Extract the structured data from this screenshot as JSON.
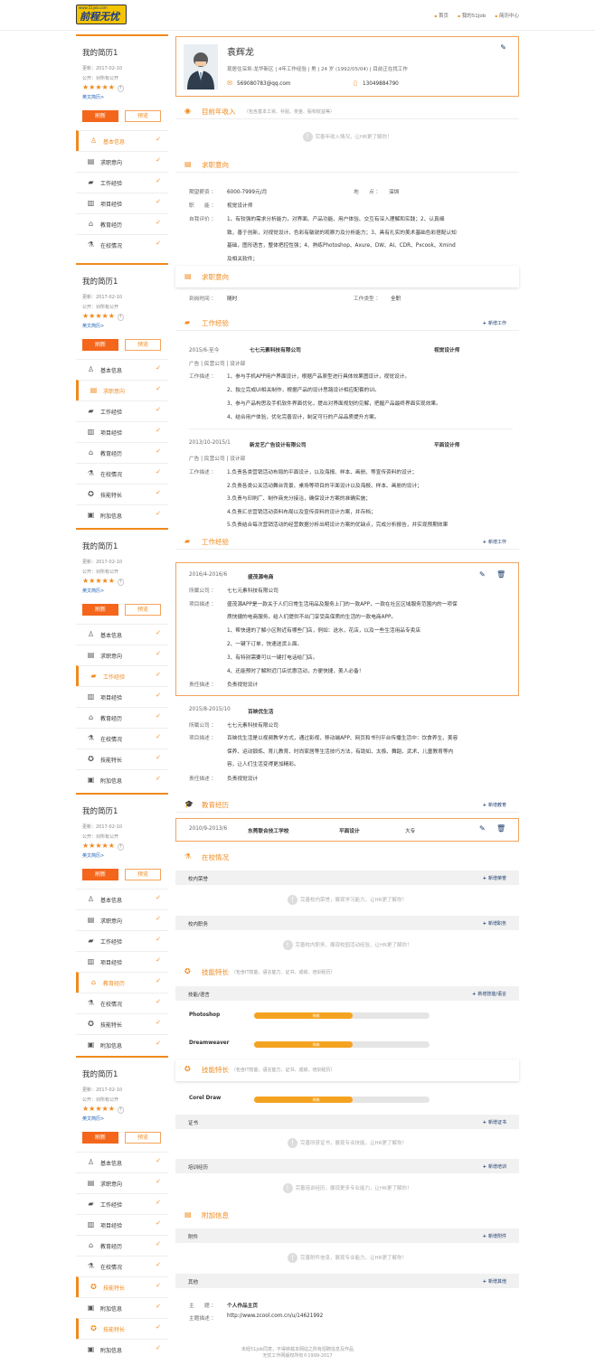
{
  "header": {
    "logo_url": "www.51job.com",
    "logo_text": "前程无忧",
    "nav": [
      "首页",
      "我的51Job",
      "简历中心"
    ]
  },
  "sidebar_blocks": [
    {
      "title": "我的简历1",
      "updated": "更新：2017-02-10",
      "public": "公开：对所有公开",
      "stars": "★★★★★",
      "en": "英文简历>",
      "refresh": "刷新",
      "preview": "预览",
      "items": [
        "基本信息",
        "求职意向",
        "工作经验",
        "项目经验",
        "教育经历",
        "在校情况"
      ]
    },
    {
      "title": "我的简历1",
      "updated": "更新：2017-02-10",
      "public": "公开：对所有公开",
      "stars": "★★★★★",
      "en": "英文简历>",
      "refresh": "刷新",
      "preview": "预览",
      "items": [
        "基本信息",
        "求职意向",
        "工作经验",
        "项目经验",
        "教育经历",
        "在校情况",
        "技能特长",
        "附加信息"
      ]
    },
    {
      "title": "我的简历1",
      "updated": "更新：2017-02-10",
      "public": "公开：对所有公开",
      "stars": "★★★★★",
      "en": "英文简历>",
      "refresh": "刷新",
      "preview": "预览",
      "items": [
        "基本信息",
        "求职意向",
        "工作经验",
        "项目经验",
        "教育经历",
        "在校情况",
        "技能特长",
        "附加信息"
      ]
    },
    {
      "title": "我的简历1",
      "updated": "更新：2017-02-10",
      "public": "公开：对所有公开",
      "stars": "★★★★★",
      "en": "英文简历>",
      "refresh": "刷新",
      "preview": "预览",
      "items": [
        "基本信息",
        "求职意向",
        "工作经验",
        "项目经验",
        "教育经历",
        "在校情况",
        "技能特长",
        "附加信息"
      ]
    },
    {
      "title": "我的简历1",
      "updated": "更新：2017-02-10",
      "public": "公开：对所有公开",
      "stars": "★★★★★",
      "en": "英文简历>",
      "refresh": "刷新",
      "preview": "预览",
      "items": [
        "基本信息",
        "求职意向",
        "工作经验",
        "项目经验",
        "教育经历",
        "在校情况",
        "技能特长",
        "附加信息",
        "技能特长",
        "附加信息"
      ]
    }
  ],
  "profile": {
    "name": "袁辉龙",
    "line": "现居住深圳-龙华新区 | 4年工作经验 | 男 | 24 岁 (1992/05/04) | 目前正在找工作",
    "email": "569080783@qq.com",
    "phone": "13049884790"
  },
  "income": {
    "title": "目前年收入",
    "sub": "（包含基本工资、补贴、奖金、股权收益等）",
    "empty": "完善年收入情况，让HR更了解你！"
  },
  "intent": {
    "title": "求职意向",
    "salary_label": "期望薪资 ：",
    "salary": "6000-7999元/月",
    "place_label": "地　　点 ：",
    "place": "深圳",
    "job_label": "职　　能 ：",
    "job": "视觉设计师",
    "eval_label": "自我评价 ：",
    "eval": [
      "1、有较强的需求分析能力，对界面、产品功能、用户体验、交互有深入理解和实践；2、认真细",
      "致，善于创新，对视觉设计、色彩有敏锐的观察力及分析能力；3、具有扎实的美术基础色彩搭配认知",
      "基础，图形语言，整体把控性强；4、熟练Photoshop、Axure、DW、AI、CDR、Pxcook、Xmind",
      "及相关软件；"
    ]
  },
  "intent2": {
    "title": "求职意向",
    "arrive_label": "到岗时间 ：",
    "arrive": "随时",
    "type_label": "工作类型 ：",
    "type": "全职"
  },
  "work": {
    "title": "工作经验",
    "add": "新增工作",
    "jobs": [
      {
        "period": "2015/6-至今",
        "company": "七七元素科技有限公司",
        "position": "视觉设计师",
        "meta": "广告 | 民营公司 | 设计部",
        "desc_label": "工作描述 ：",
        "desc": [
          "1、参与手机APP用户界面设计，根据产品原型进行具体效果图设计，视觉设计。",
          "2、独立完成UI相关制作，根据产品的设计思路设计相应配套的UI。",
          "3、参与产品构思及手机软件界面优化，提出对界面规划的见解，把握产品最终界面实现效果。",
          "4、结合用户体验，优化完善设计，制定可行的产品品质提升方案。"
        ]
      },
      {
        "period": "2013/10-2015/1",
        "company": "新龙艺广告设计有限公司",
        "position": "平面设计师",
        "meta": "广告 | 民营公司 | 设计部",
        "desc_label": "工作描述 ：",
        "desc": [
          "1.负责各类营销活动布局的平面设计，以及海报、样本、画册、等宣传资料的设计；",
          "2.负责各类公关活动舞台背景、桌场等项目的平面设计以及海报、样本、画册的设计；",
          "3.负责与印刷厂、制作商充分接洽，确保设计方案的准确实施；",
          "4.负责汇总营销活动资料布局以及宣传资料的设计方案，并存档；",
          "5.负责结合每次营销活动的经营数据分析出明设计方案的优缺点，完成分析报告，并实现预期效果"
        ]
      }
    ]
  },
  "project": {
    "title": "工作经验",
    "add": "新增工作",
    "items": [
      {
        "period": "2016/4-2016/6",
        "name": "盛茂源电商",
        "company_label": "所属公司 ：",
        "company": "七七元素科技有限公司",
        "desc_label": "项目描述 ：",
        "desc": [
          "盛茂源APP是一款关于人们日常生活用品及服务上门的一款APP，一款在社区区域服务范围内的一项保",
          "质快捷的电商服务。给人们提供不出门享受高保质的生活的一款电商APP。",
          "1、帮快速的了解小区附近有哪些门店，例如：送水，花店，以及一些生活用品专卖店",
          "2、一键下订单，快速送货上面。",
          "3、有特别需要可以一键打电话给门店。",
          "4、还能预时了解附近门店优惠活动，方便快捷，美人必备！"
        ],
        "duty_label": "责任描述 ：",
        "duty": "负责视觉设计"
      },
      {
        "period": "2015/8-2015/10",
        "name": "百映优生活",
        "company_label": "所属公司 ：",
        "company": "七七元素科技有限公司",
        "desc_label": "项目描述 ：",
        "desc": [
          "百映优生活是以视频教学方式，通过影视、移动端APP、网页和书刊平台传播生活中：饮食养生、美容",
          "保养、运动锻炼、育儿教育、时尚家居等生活技巧方法，有助如、太极、舞蹈、武术、儿童教育等内",
          "容，让人们生活变得更加精彩。"
        ],
        "duty_label": "责任描述 ：",
        "duty": "负责视觉设计"
      }
    ]
  },
  "edu": {
    "title": "教育经历",
    "add": "新增教育",
    "period": "2010/9-2013/6",
    "school": "东莞联合技工学校",
    "major": "平面设计",
    "degree": "大专"
  },
  "campus": {
    "title": "在校情况",
    "honor": "校内荣誉",
    "honor_add": "新增荣誉",
    "honor_empty": "完善校内荣誉，展现学习能力，让HR更了解你！",
    "post": "校内职务",
    "post_add": "新增职务",
    "post_empty": "完善校内职务，展现校园活动经验，让HR更了解你！"
  },
  "skills": {
    "title": "技能特长",
    "sub": "（包含IT技能、语言能力、证书、成绩、培训经历）",
    "lang": "技能/语言",
    "lang_add": "新增技能/语言",
    "list": [
      {
        "name": "Photoshop",
        "level": "熟练",
        "value": 0.56
      },
      {
        "name": "Dreamweaver",
        "level": "熟练",
        "value": 0.56
      }
    ]
  },
  "skills2": {
    "title": "技能特长",
    "sub": "（包含IT技能、语言能力、证书、成绩、培训经历）",
    "list": [
      {
        "name": "Corel Draw",
        "level": "熟练",
        "value": 0.56
      }
    ],
    "cert": "证书",
    "cert_add": "新增证书",
    "cert_empty": "完善所获证书，展现专业技能，让HR更了解你！",
    "train": "培训经历",
    "train_add": "新增培训",
    "train_empty": "完善培训经历，展现更多专业能力，让HR更了解你！"
  },
  "extra": {
    "title": "附加信息",
    "attach": "附件",
    "attach_add": "新增附件",
    "attach_empty": "完善附件信息，展现专业能力，让HR更了解你！",
    "other": "其他",
    "other_add": "新增其他",
    "topic_label": "主　　题 ：",
    "topic": "个人作品主页",
    "desc_label": "主题描述 ：",
    "desc": "http://www.zcool.com.cn/u/14621992"
  },
  "footer": [
    "未经51job同意，不得转载本网站之所有招聘信息及作品",
    "无忧工作网版权所有©1999-2017"
  ]
}
